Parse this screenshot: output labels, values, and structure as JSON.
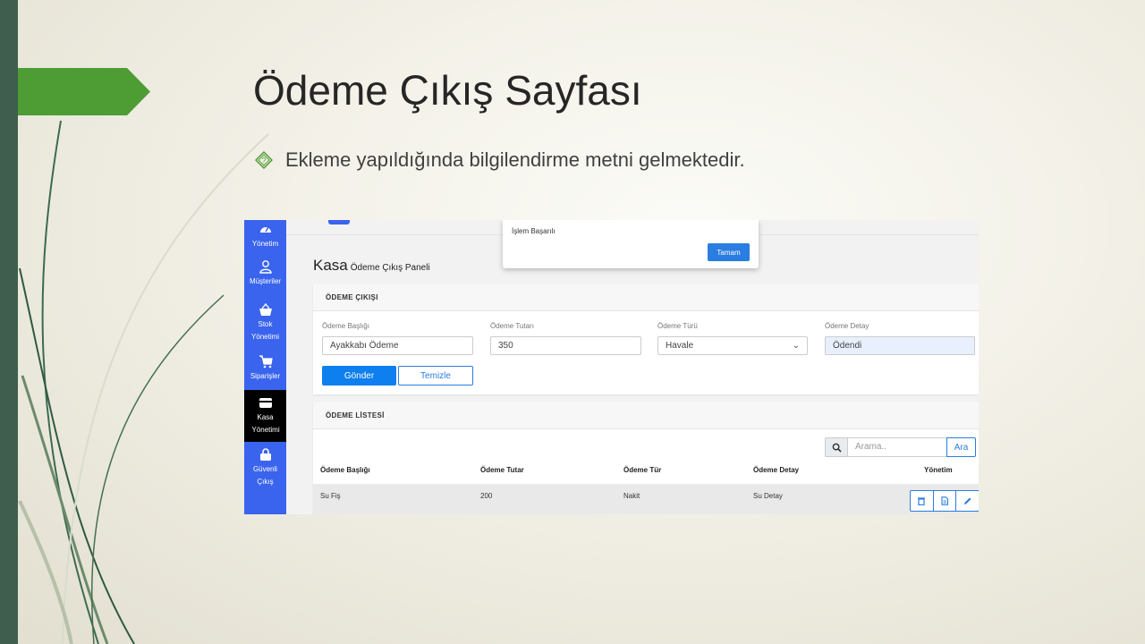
{
  "slide": {
    "title": "Ödeme Çıkış Sayfası",
    "bullet": "Ekleme yapıldığında bilgilendirme metni gelmektedir.",
    "bullet_icon": "diamond-question-icon"
  },
  "sidebar": {
    "items": [
      {
        "label": "Yönetim",
        "icon": "dashboard-icon"
      },
      {
        "label": "Müşteriler",
        "icon": "user-icon"
      },
      {
        "label": "Stok Yönetimi",
        "icon": "basket-icon"
      },
      {
        "label": "Siparişler",
        "icon": "cart-icon"
      },
      {
        "label": "Kasa Yönetimi",
        "icon": "wallet-icon",
        "active": true
      },
      {
        "label": "Güvenli Çıkış",
        "icon": "lock-icon"
      }
    ]
  },
  "modal": {
    "message": "İşlem Başarılı",
    "button": "Tamam"
  },
  "page": {
    "title": "Kasa",
    "subtitle": "Ödeme Çıkış Paneli"
  },
  "form": {
    "header": "ÖDEME ÇIKIŞI",
    "fields": [
      {
        "label": "Ödeme Başlığı",
        "value": "Ayakkabı Ödeme"
      },
      {
        "label": "Ödeme Tutarı",
        "value": "350"
      },
      {
        "label": "Ödeme Türü",
        "value": "Havale"
      },
      {
        "label": "Ödeme Detay",
        "value": "Ödendi"
      }
    ],
    "submit": "Gönder",
    "clear": "Temizle"
  },
  "list": {
    "header": "ÖDEME LİSTESİ",
    "search_placeholder": "Arama..",
    "search_button": "Ara",
    "columns": [
      "Ödeme Başlığı",
      "Ödeme Tutar",
      "Ödeme Tür",
      "Ödeme Detay",
      "Yönetim"
    ],
    "rows": [
      {
        "baslik": "Su Fiş",
        "tutar": "200",
        "tur": "Nakit",
        "detay": "Su Detay"
      }
    ]
  },
  "colors": {
    "sidebar": "#3a63ee",
    "primary": "#0d7fef",
    "accent_green": "#4e9c34",
    "dark_band": "#3f5e4e"
  }
}
